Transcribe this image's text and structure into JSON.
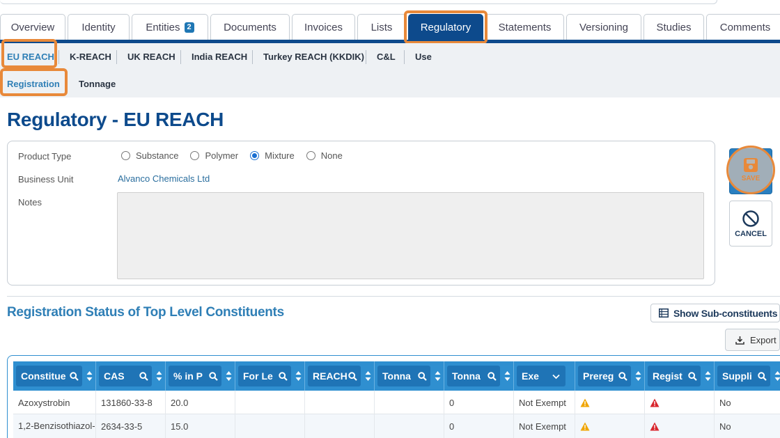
{
  "main_tabs": [
    {
      "label": "Overview"
    },
    {
      "label": "Identity"
    },
    {
      "label": "Entities",
      "badge": "2"
    },
    {
      "label": "Documents"
    },
    {
      "label": "Invoices"
    },
    {
      "label": "Lists"
    },
    {
      "label": "Regulatory",
      "active": true
    },
    {
      "label": "Statements"
    },
    {
      "label": "Versioning"
    },
    {
      "label": "Studies"
    },
    {
      "label": "Comments"
    }
  ],
  "sub_nav": [
    "EU REACH",
    "K-REACH",
    "UK REACH",
    "India REACH",
    "Turkey REACH (KKDIK)",
    "C&L",
    "Use"
  ],
  "sub_nav2": [
    "Registration",
    "Tonnage"
  ],
  "page_title": "Regulatory - EU REACH",
  "form": {
    "product_type_label": "Product Type",
    "product_type_options": [
      "Substance",
      "Polymer",
      "Mixture",
      "None"
    ],
    "product_type_selected": "Mixture",
    "business_unit_label": "Business Unit",
    "business_unit_value": "Alvanco Chemicals Ltd",
    "notes_label": "Notes",
    "notes_value": ""
  },
  "actions": {
    "save": "SAVE",
    "cancel": "CANCEL"
  },
  "section": {
    "title": "Registration Status of Top Level Constituents",
    "show_sub_button": "Show Sub-constituents",
    "export_button": "Export"
  },
  "table": {
    "headers": [
      "Constitue",
      "CAS",
      "% in P",
      "For Le",
      "REACH",
      "Tonna",
      "Tonna",
      "Exe",
      "Prereg",
      "Regist",
      "Suppli"
    ],
    "rows": [
      [
        "Azoxystrobin",
        "131860-33-8",
        "20.0",
        "",
        "",
        "",
        "0",
        "Not Exempt",
        "warn",
        "error",
        "No"
      ],
      [
        "1,2-Benzisothiazol-",
        "2634-33-5",
        "15.0",
        "",
        "",
        "",
        "0",
        "Not Exempt",
        "warn",
        "error",
        "No"
      ]
    ]
  },
  "colors": {
    "brand": "#0d4a8c",
    "accent": "#2f8fd0",
    "highlight": "#e8893a",
    "warning": "#f0a500",
    "error": "#d9262d"
  }
}
